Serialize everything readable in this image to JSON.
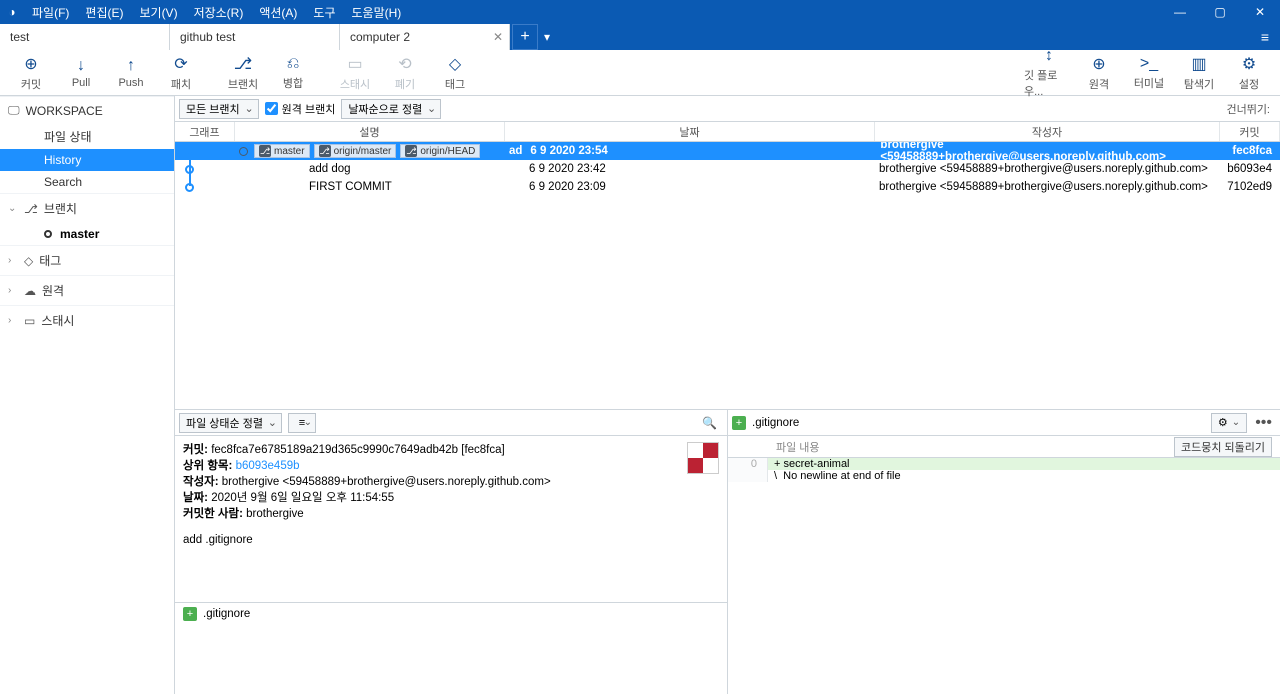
{
  "menubar": {
    "items": [
      "파일(F)",
      "편집(E)",
      "보기(V)",
      "저장소(R)",
      "액션(A)",
      "도구",
      "도움말(H)"
    ]
  },
  "tabs": [
    {
      "label": "test",
      "closable": false
    },
    {
      "label": "github test",
      "closable": false
    },
    {
      "label": "computer 2",
      "closable": true,
      "active": true
    }
  ],
  "toolbar": {
    "left": [
      {
        "name": "commit",
        "label": "커밋",
        "icon": "⊕"
      },
      {
        "name": "pull",
        "label": "Pull",
        "icon": "↓"
      },
      {
        "name": "push",
        "label": "Push",
        "icon": "↑"
      },
      {
        "name": "fetch",
        "label": "패치",
        "icon": "⟳"
      },
      {
        "name": "branch",
        "label": "브랜치",
        "icon": "⎇"
      },
      {
        "name": "merge",
        "label": "병합",
        "icon": "⎌"
      },
      {
        "name": "stash",
        "label": "스태시",
        "icon": "▭",
        "disabled": true
      },
      {
        "name": "discard",
        "label": "폐기",
        "icon": "⟲",
        "disabled": true
      },
      {
        "name": "tag",
        "label": "태그",
        "icon": "◇"
      }
    ],
    "right": [
      {
        "name": "gitflow",
        "label": "깃 플로우...",
        "icon": "↕"
      },
      {
        "name": "remote",
        "label": "원격",
        "icon": "⊕"
      },
      {
        "name": "terminal",
        "label": "터미널",
        "icon": ">_"
      },
      {
        "name": "explorer",
        "label": "탐색기",
        "icon": "▥"
      },
      {
        "name": "settings",
        "label": "설정",
        "icon": "⚙"
      }
    ]
  },
  "sidebar": {
    "workspace": {
      "label": "WORKSPACE",
      "items": [
        "파일 상태",
        "History",
        "Search"
      ],
      "selected": 1
    },
    "branch": {
      "label": "브랜치",
      "items": [
        "master"
      ]
    },
    "tag": {
      "label": "태그"
    },
    "remote": {
      "label": "원격"
    },
    "stash": {
      "label": "스태시"
    }
  },
  "filterbar": {
    "allBranches": "모든 브랜치",
    "remoteBranches": "원격 브랜치",
    "sortDate": "날짜순으로 정렬",
    "skip": "건너뛰기:"
  },
  "grid": {
    "headers": {
      "graph": "그래프",
      "desc": "설명",
      "date": "날짜",
      "author": "작성자",
      "commit": "커밋"
    },
    "rows": [
      {
        "selected": true,
        "branches": [
          "master",
          "origin/master",
          "origin/HEAD"
        ],
        "desc": "ad",
        "date": "6 9 2020 23:54",
        "author": "brothergive <59458889+brothergive@users.noreply.github.com>",
        "commit": "fec8fca"
      },
      {
        "selected": false,
        "desc": "add dog",
        "date": "6 9 2020 23:42",
        "author": "brothergive <59458889+brothergive@users.noreply.github.com>",
        "commit": "b6093e4"
      },
      {
        "selected": false,
        "desc": "FIRST COMMIT",
        "date": "6 9 2020 23:09",
        "author": "brothergive <59458889+brothergive@users.noreply.github.com>",
        "commit": "7102ed9"
      }
    ]
  },
  "detail": {
    "sort": "파일 상태순 정렬",
    "commitLabel": "커밋:",
    "commitFull": "fec8fca7e6785189a219d365c9990c7649adb42b [fec8fca]",
    "parentLabel": "상위 항목:",
    "parent": "b6093e459b",
    "authorLabel": "작성자:",
    "authorFull": "brothergive <59458889+brothergive@users.noreply.github.com>",
    "dateLabel": "날짜:",
    "dateFull": "2020년 9월 6일 일요일 오후 11:54:55",
    "committerLabel": "커밋한 사람:",
    "committer": "brothergive",
    "message": "add .gitignore",
    "files": [
      ".gitignore"
    ]
  },
  "diff": {
    "file": ".gitignore",
    "contentLabel": "파일 내용",
    "revert": "코드뭉치 되돌리기",
    "lines": [
      {
        "num": "0",
        "text": "+ secret-animal",
        "type": "add"
      },
      {
        "num": "",
        "text": "\\  No newline at end of file",
        "type": ""
      }
    ]
  }
}
